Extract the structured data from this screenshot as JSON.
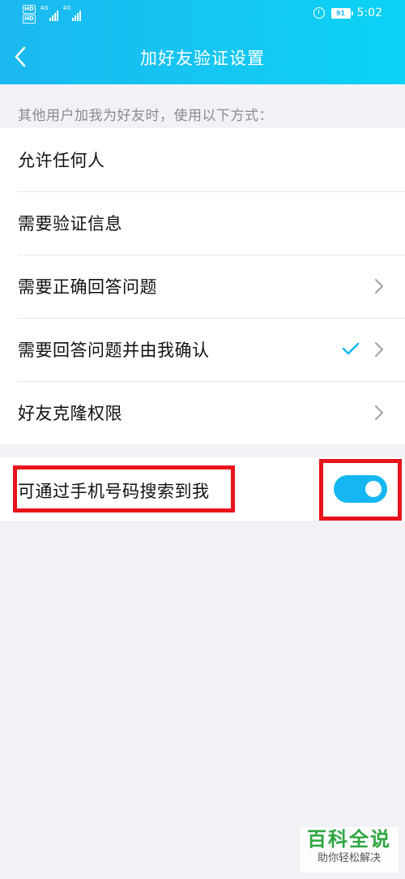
{
  "status_bar": {
    "hd_badge_1": "HD",
    "hd_badge_2": "HD",
    "signal_1_label": "4G",
    "signal_2_label": "4G",
    "battery_level": "91",
    "time": "5:02"
  },
  "header": {
    "title": "加好友验证设置"
  },
  "hint": "其他用户加我为好友时，使用以下方式：",
  "options": [
    {
      "label": "允许任何人",
      "has_chevron": false,
      "checked": false
    },
    {
      "label": "需要验证信息",
      "has_chevron": false,
      "checked": false
    },
    {
      "label": "需要正确回答问题",
      "has_chevron": true,
      "checked": false
    },
    {
      "label": "需要回答问题并由我确认",
      "has_chevron": true,
      "checked": true
    },
    {
      "label": "好友克隆权限",
      "has_chevron": true,
      "checked": false
    }
  ],
  "phone_search": {
    "label": "可通过手机号码搜索到我",
    "enabled": true
  },
  "watermark": {
    "main": "百科全说",
    "sub": "助你轻松解决"
  },
  "colors": {
    "header_start": "#1ab8f0",
    "header_end": "#0ad2f5",
    "accent": "#14b7f2",
    "highlight_red": "#e8141b",
    "watermark_green": "#2ea640"
  }
}
